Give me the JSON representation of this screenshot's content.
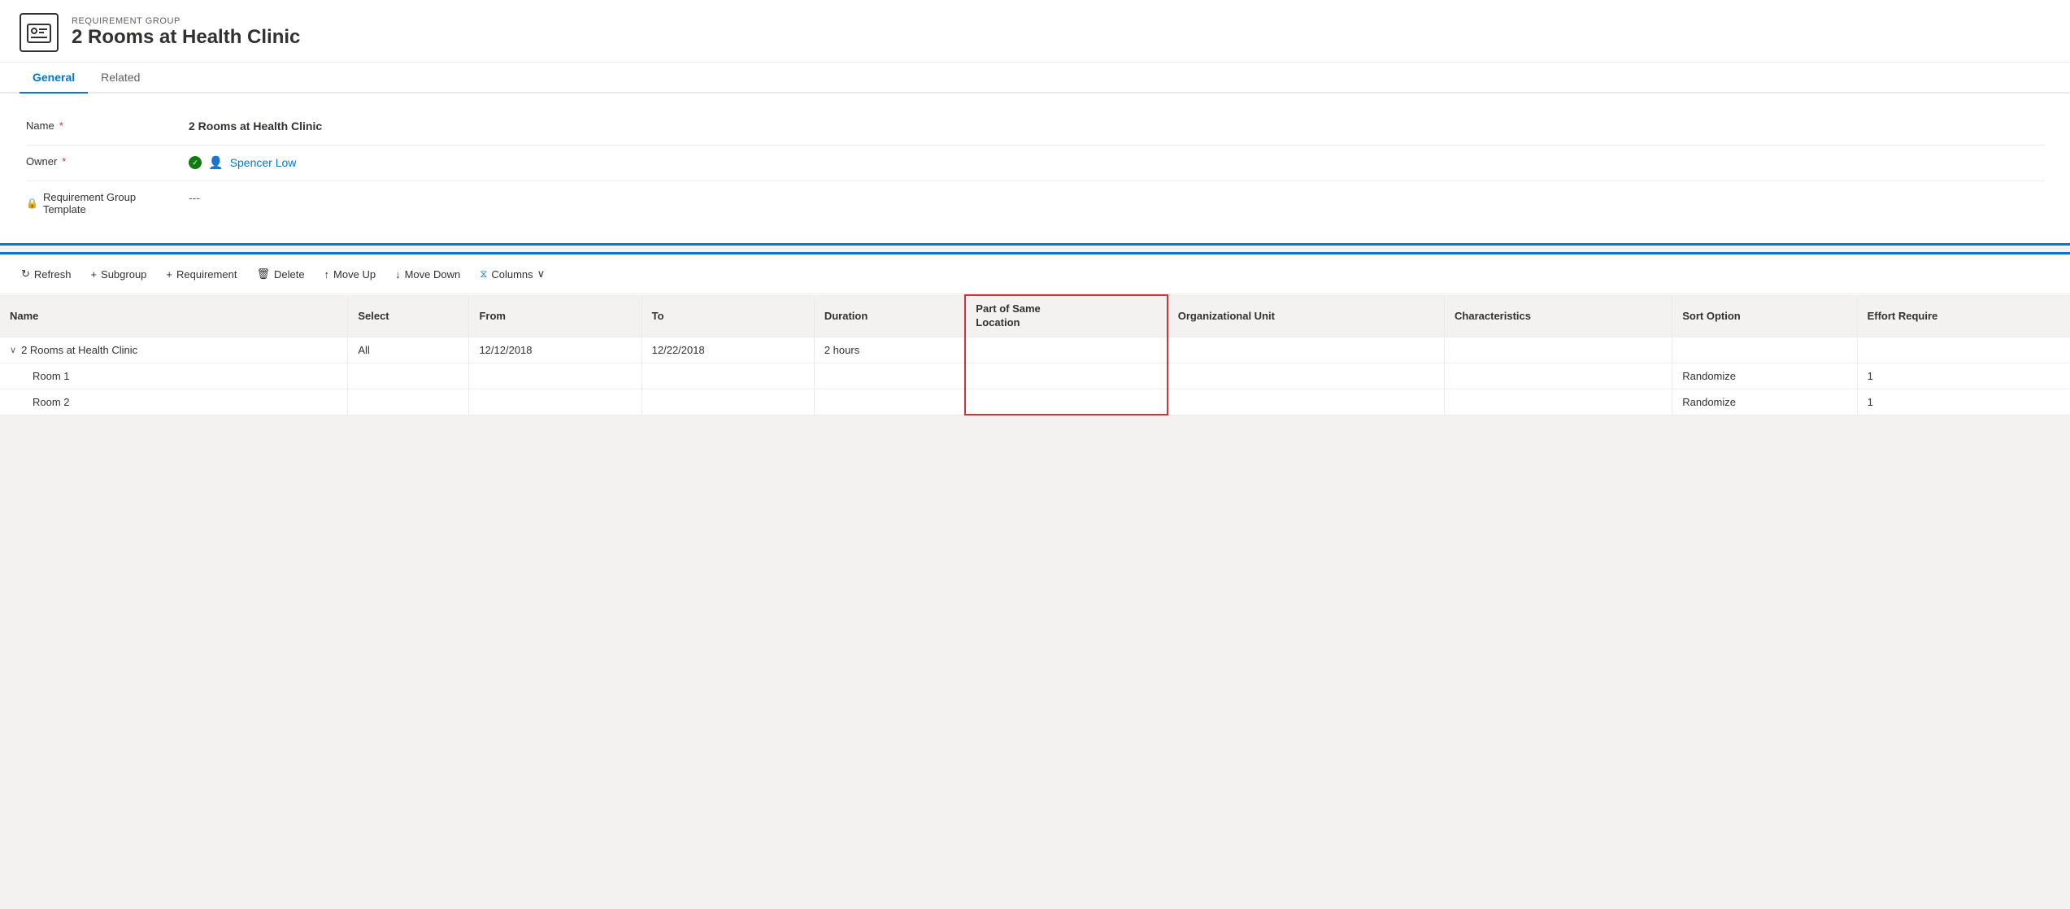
{
  "header": {
    "subtitle": "REQUIREMENT GROUP",
    "title": "2 Rooms at Health Clinic"
  },
  "tabs": [
    {
      "id": "general",
      "label": "General",
      "active": true
    },
    {
      "id": "related",
      "label": "Related",
      "active": false
    }
  ],
  "form": {
    "fields": [
      {
        "id": "name",
        "label": "Name",
        "required": true,
        "locked": false,
        "value": "2 Rooms at Health Clinic",
        "type": "text"
      },
      {
        "id": "owner",
        "label": "Owner",
        "required": true,
        "locked": false,
        "value": "Spencer Low",
        "type": "person"
      },
      {
        "id": "template",
        "label": "Requirement Group Template",
        "label2": "Template",
        "required": false,
        "locked": true,
        "value": "---",
        "type": "text"
      }
    ]
  },
  "toolbar": {
    "buttons": [
      {
        "id": "refresh",
        "label": "Refresh",
        "icon": "↻",
        "disabled": false,
        "prefix": ""
      },
      {
        "id": "subgroup",
        "label": "Subgroup",
        "icon": "+",
        "disabled": false,
        "prefix": ""
      },
      {
        "id": "requirement",
        "label": "Requirement",
        "icon": "+",
        "disabled": false,
        "prefix": ""
      },
      {
        "id": "delete",
        "label": "Delete",
        "icon": "🗑",
        "disabled": false,
        "prefix": ""
      },
      {
        "id": "move-up",
        "label": "Move Up",
        "icon": "↑",
        "disabled": false,
        "prefix": ""
      },
      {
        "id": "move-down",
        "label": "Move Down",
        "icon": "↓",
        "disabled": false,
        "prefix": ""
      },
      {
        "id": "columns",
        "label": "Columns",
        "icon": "▽",
        "disabled": false,
        "prefix": "⧖"
      }
    ]
  },
  "table": {
    "columns": [
      {
        "id": "name",
        "label": "Name"
      },
      {
        "id": "select",
        "label": "Select"
      },
      {
        "id": "from",
        "label": "From"
      },
      {
        "id": "to",
        "label": "To"
      },
      {
        "id": "duration",
        "label": "Duration"
      },
      {
        "id": "part-of-same",
        "label": "Part of Same",
        "label2": "Location",
        "highlighted": true
      },
      {
        "id": "org-unit",
        "label": "Organizational Unit"
      },
      {
        "id": "characteristics",
        "label": "Characteristics"
      },
      {
        "id": "sort-option",
        "label": "Sort Option"
      },
      {
        "id": "effort-required",
        "label": "Effort Require"
      }
    ],
    "rows": [
      {
        "id": "group-row",
        "name": "2 Rooms at Health Clinic",
        "isGroup": true,
        "select": "All",
        "from": "12/12/2018",
        "to": "12/22/2018",
        "duration": "2 hours",
        "partOfSame": "",
        "orgUnit": "",
        "characteristics": "",
        "sortOption": "",
        "effortRequired": ""
      },
      {
        "id": "room1-row",
        "name": "Room 1",
        "isGroup": false,
        "select": "",
        "from": "",
        "to": "",
        "duration": "",
        "partOfSame": "",
        "orgUnit": "",
        "characteristics": "",
        "sortOption": "Randomize",
        "effortRequired": "1"
      },
      {
        "id": "room2-row",
        "name": "Room 2",
        "isGroup": false,
        "select": "",
        "from": "",
        "to": "",
        "duration": "",
        "partOfSame": "",
        "orgUnit": "",
        "characteristics": "",
        "sortOption": "Randomize",
        "effortRequired": "1"
      }
    ]
  }
}
